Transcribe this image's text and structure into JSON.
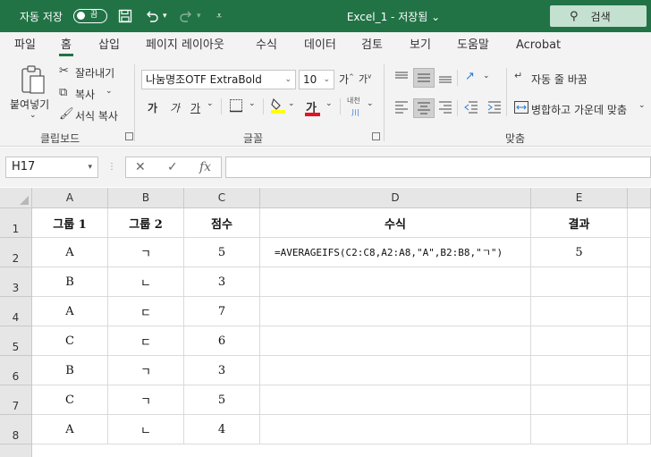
{
  "titlebar": {
    "autosave_label": "자동 저장",
    "autosave_state": "끔",
    "doc_title": "Excel_1 - 저장됨 ⌄",
    "search_label": "검색",
    "bg_color": "#217346"
  },
  "tabs": [
    {
      "label": "파일"
    },
    {
      "label": "홈"
    },
    {
      "label": "삽입"
    },
    {
      "label": "페이지 레이아웃"
    },
    {
      "label": "수식"
    },
    {
      "label": "데이터"
    },
    {
      "label": "검토"
    },
    {
      "label": "보기"
    },
    {
      "label": "도움말"
    },
    {
      "label": "Acrobat"
    }
  ],
  "ribbon": {
    "clipboard": {
      "paste_label": "붙여넣기",
      "cut_label": "잘라내기",
      "copy_label": "복사",
      "format_painter_label": "서식 복사",
      "group_label": "클립보드"
    },
    "font": {
      "font_name": "나눔명조OTF ExtraBold",
      "font_size": "10",
      "bold": "가",
      "italic": "가",
      "underline": "가",
      "font_color_glyph": "가",
      "phonetic": "내천",
      "group_label": "글꼴"
    },
    "alignment": {
      "wrap_text_label": "자동 줄 바꿈",
      "merge_label": "병합하고 가운데 맞춤",
      "group_label": "맞춤"
    }
  },
  "formula_bar": {
    "name_box": "H17",
    "formula": ""
  },
  "sheet": {
    "columns": [
      "A",
      "B",
      "C",
      "D",
      "E"
    ],
    "rows": [
      {
        "num": "1",
        "cells": [
          "그룹 1",
          "그룹 2",
          "점수",
          "수식",
          "결과"
        ]
      },
      {
        "num": "2",
        "cells": [
          "A",
          "ㄱ",
          "5",
          "=AVERAGEIFS(C2:C8,A2:A8,\"A\",B2:B8,\"ㄱ\")",
          "5"
        ]
      },
      {
        "num": "3",
        "cells": [
          "B",
          "ㄴ",
          "3",
          "",
          ""
        ]
      },
      {
        "num": "4",
        "cells": [
          "A",
          "ㄷ",
          "7",
          "",
          ""
        ]
      },
      {
        "num": "5",
        "cells": [
          "C",
          "ㄷ",
          "6",
          "",
          ""
        ]
      },
      {
        "num": "6",
        "cells": [
          "B",
          "ㄱ",
          "3",
          "",
          ""
        ]
      },
      {
        "num": "7",
        "cells": [
          "C",
          "ㄱ",
          "5",
          "",
          ""
        ]
      },
      {
        "num": "8",
        "cells": [
          "A",
          "ㄴ",
          "4",
          "",
          ""
        ]
      }
    ]
  }
}
